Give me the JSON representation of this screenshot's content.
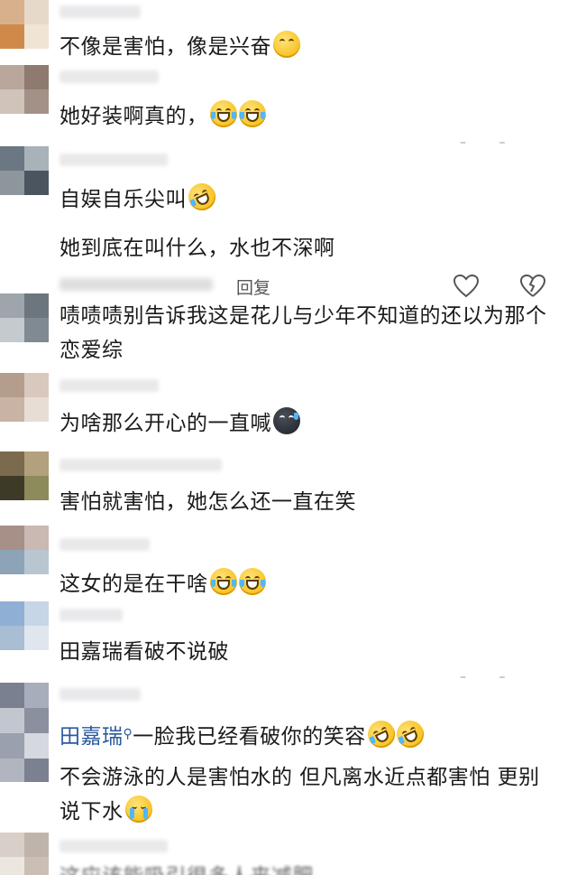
{
  "comments": [
    {
      "text": "不像是害怕，像是兴奋",
      "emoji": "sunglasses-smile-emoji"
    },
    {
      "text": "她好装啊真的，",
      "emoji": "laugh-cry-emoji"
    },
    {
      "text": "自娱自乐尖叫",
      "emoji": "rofl-emoji"
    },
    {
      "text": "她到底在叫什么，水也不深啊"
    },
    {
      "text": "啧啧啧别告诉我这是花儿与少年不知道的还以为那个恋爱综"
    },
    {
      "text": "为啥那么开心的一直喊",
      "emoji": "sweat-face-emoji"
    },
    {
      "text": "害怕就害怕，她怎么还一直在笑"
    },
    {
      "text": "这女的是在干啥",
      "emoji": "laugh-cry-emoji"
    },
    {
      "text": "田嘉瑞看破不说破"
    },
    {
      "username": "田嘉瑞",
      "text": "一脸我已经看破你的笑容",
      "emoji": "rofl-emoji"
    },
    {
      "text": "不会游泳的人是害怕水的 但凡离水近点都害怕 更别说下水",
      "emoji": "crying-emoji"
    },
    {
      "text": "这应该能吸引很多人来减肥"
    }
  ],
  "meta": {
    "reply_label": "回复",
    "dash": "– –"
  },
  "icons": {
    "like": "heart-outline-icon",
    "dislike": "broken-heart-icon",
    "search": "search-icon"
  },
  "colors": {
    "username": "#2b5a9e",
    "emoji_yellow": "#f4b400"
  }
}
